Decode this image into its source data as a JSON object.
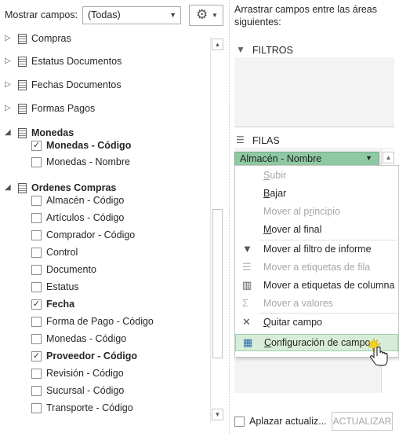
{
  "header": {
    "show_fields_label": "Mostrar campos:",
    "show_fields_value": "(Todas)",
    "tools_icon": "gear-icon"
  },
  "field_list": {
    "items": [
      {
        "type": "group",
        "label": "Compras",
        "expanded": false
      },
      {
        "type": "group",
        "label": "Estatus Documentos",
        "expanded": false
      },
      {
        "type": "group",
        "label": "Fechas Documentos",
        "expanded": false
      },
      {
        "type": "group",
        "label": "Formas Pagos",
        "expanded": false
      },
      {
        "type": "group",
        "label": "Monedas",
        "expanded": true
      },
      {
        "type": "field",
        "label": "Monedas - Código",
        "checked": true
      },
      {
        "type": "field",
        "label": "Monedas - Nombre",
        "checked": false
      },
      {
        "type": "group",
        "label": "Ordenes Compras",
        "expanded": true
      },
      {
        "type": "field",
        "label": "Almacén - Código",
        "checked": false
      },
      {
        "type": "field",
        "label": "Artículos - Código",
        "checked": false
      },
      {
        "type": "field",
        "label": "Comprador - Código",
        "checked": false
      },
      {
        "type": "field",
        "label": "Control",
        "checked": false
      },
      {
        "type": "field",
        "label": "Documento",
        "checked": false
      },
      {
        "type": "field",
        "label": "Estatus",
        "checked": false
      },
      {
        "type": "field",
        "label": "Fecha",
        "checked": true
      },
      {
        "type": "field",
        "label": "Forma de Pago - Código",
        "checked": false
      },
      {
        "type": "field",
        "label": "Monedas - Código",
        "checked": false
      },
      {
        "type": "field",
        "label": "Proveedor - Código",
        "checked": true
      },
      {
        "type": "field",
        "label": "Revisión - Código",
        "checked": false
      },
      {
        "type": "field",
        "label": "Sucursal - Código",
        "checked": false
      },
      {
        "type": "field",
        "label": "Transporte - Código",
        "checked": false
      }
    ]
  },
  "areas": {
    "instructions": "Arrastrar campos entre las áreas siguientes:",
    "filters_label": "FILTROS",
    "rows_label": "FILAS",
    "rows_field": "Almacén - Nombre"
  },
  "context_menu": {
    "items": [
      {
        "pre": "",
        "u": "S",
        "post": "ubir",
        "enabled": false,
        "icon": ""
      },
      {
        "pre": "",
        "u": "B",
        "post": "ajar",
        "enabled": true,
        "icon": ""
      },
      {
        "pre": "Mover al p",
        "u": "r",
        "post": "incipio",
        "enabled": false,
        "icon": ""
      },
      {
        "pre": "",
        "u": "M",
        "post": "over al final",
        "enabled": true,
        "icon": ""
      },
      {
        "pre": "Mover al filtro de informe",
        "u": "",
        "post": "",
        "enabled": true,
        "icon": "filter-icon"
      },
      {
        "pre": "Mover a etiquetas de fila",
        "u": "",
        "post": "",
        "enabled": false,
        "icon": "rows-icon"
      },
      {
        "pre": "Mover a etiquetas de columna",
        "u": "",
        "post": "",
        "enabled": true,
        "icon": "columns-icon"
      },
      {
        "pre": "Mover a valores",
        "u": "",
        "post": "",
        "enabled": false,
        "icon": "sigma-icon"
      },
      {
        "pre": "",
        "u": "Q",
        "post": "uitar campo",
        "enabled": true,
        "icon": "remove-icon"
      },
      {
        "pre": "",
        "u": "C",
        "post": "onfiguración de campo...",
        "enabled": true,
        "icon": "field-settings-icon",
        "highlighted": true
      }
    ]
  },
  "footer": {
    "defer_label": "Aplazar actualiz...",
    "update_button": "ACTUALIZAR"
  }
}
